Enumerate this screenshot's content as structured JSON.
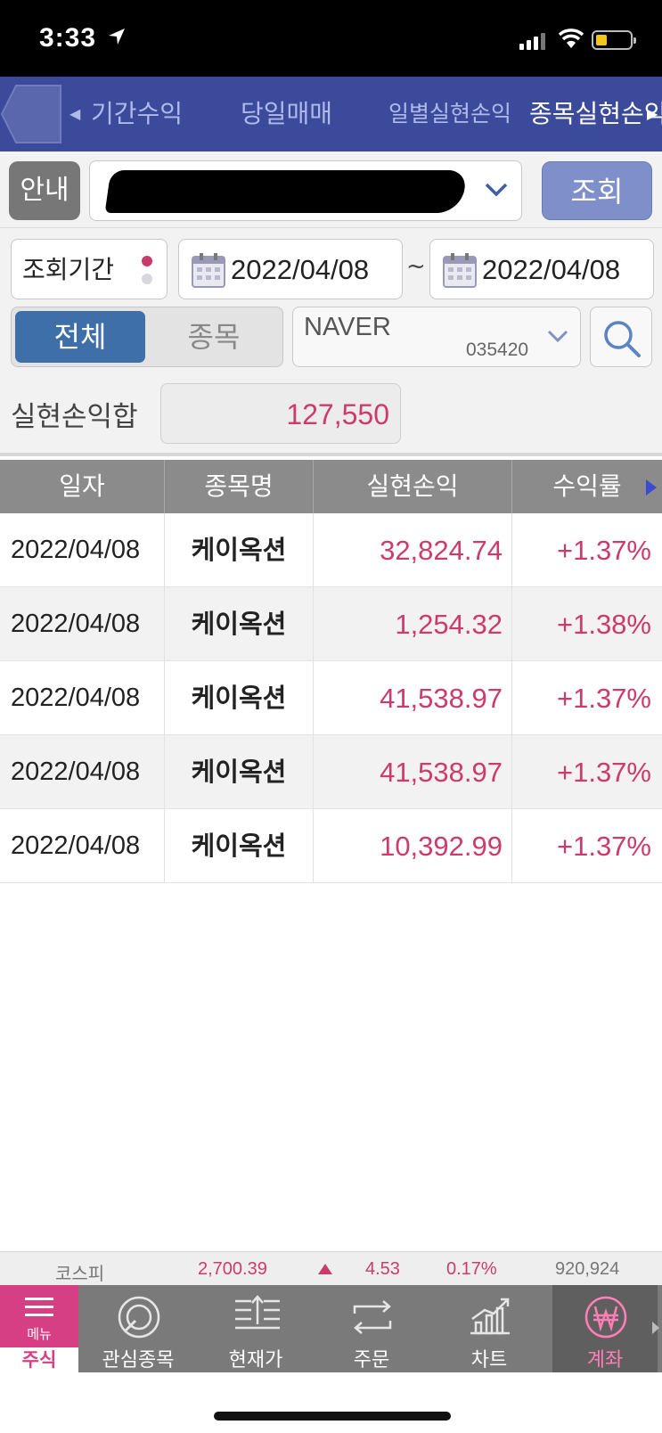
{
  "status_bar": {
    "time": "3:33"
  },
  "tabs": {
    "items": [
      {
        "label": "기간수익"
      },
      {
        "label": "당일매매"
      },
      {
        "label": "일별실현손익"
      },
      {
        "label": "종목실현손익"
      }
    ],
    "active_index": 3
  },
  "search": {
    "guide_label": "안내",
    "account_value": "",
    "query_label": "조회"
  },
  "period": {
    "label": "조회기간",
    "start_date": "2022/04/08",
    "separator": "~",
    "end_date": "2022/04/08"
  },
  "filter": {
    "all_label": "전체",
    "stock_label": "종목",
    "selected": "전체",
    "stock_name": "NAVER",
    "stock_code": "035420"
  },
  "summary": {
    "label": "실현손익합",
    "value": "127,550"
  },
  "table": {
    "columns": [
      "일자",
      "종목명",
      "실현손익",
      "수익률"
    ],
    "rows": [
      {
        "date": "2022/04/08",
        "name": "케이옥션",
        "pnl": "32,824.74",
        "rate": "+1.37%"
      },
      {
        "date": "2022/04/08",
        "name": "케이옥션",
        "pnl": "1,254.32",
        "rate": "+1.38%"
      },
      {
        "date": "2022/04/08",
        "name": "케이옥션",
        "pnl": "41,538.97",
        "rate": "+1.37%"
      },
      {
        "date": "2022/04/08",
        "name": "케이옥션",
        "pnl": "41,538.97",
        "rate": "+1.37%"
      },
      {
        "date": "2022/04/08",
        "name": "케이옥션",
        "pnl": "10,392.99",
        "rate": "+1.37%"
      }
    ]
  },
  "ticker": {
    "index_name": "코스피",
    "value": "2,700.39",
    "direction_icon": "up-triangle-icon",
    "change": "4.53",
    "change_pct": "0.17%",
    "volume": "920,924"
  },
  "bottom_nav": {
    "menu_label": "메뉴",
    "category_label": "주식",
    "items": [
      {
        "label": "관심종목",
        "icon": "watchlist-icon"
      },
      {
        "label": "현재가",
        "icon": "current-price-icon"
      },
      {
        "label": "주문",
        "icon": "order-icon"
      },
      {
        "label": "차트",
        "icon": "chart-icon"
      },
      {
        "label": "계좌",
        "icon": "won-account-icon"
      }
    ],
    "active_index": 4
  },
  "colors": {
    "nav_blue": "#3c4a9c",
    "profit_red": "#cc3b6b",
    "segment_active": "#3e6fa8",
    "menu_pink": "#d63f83"
  }
}
